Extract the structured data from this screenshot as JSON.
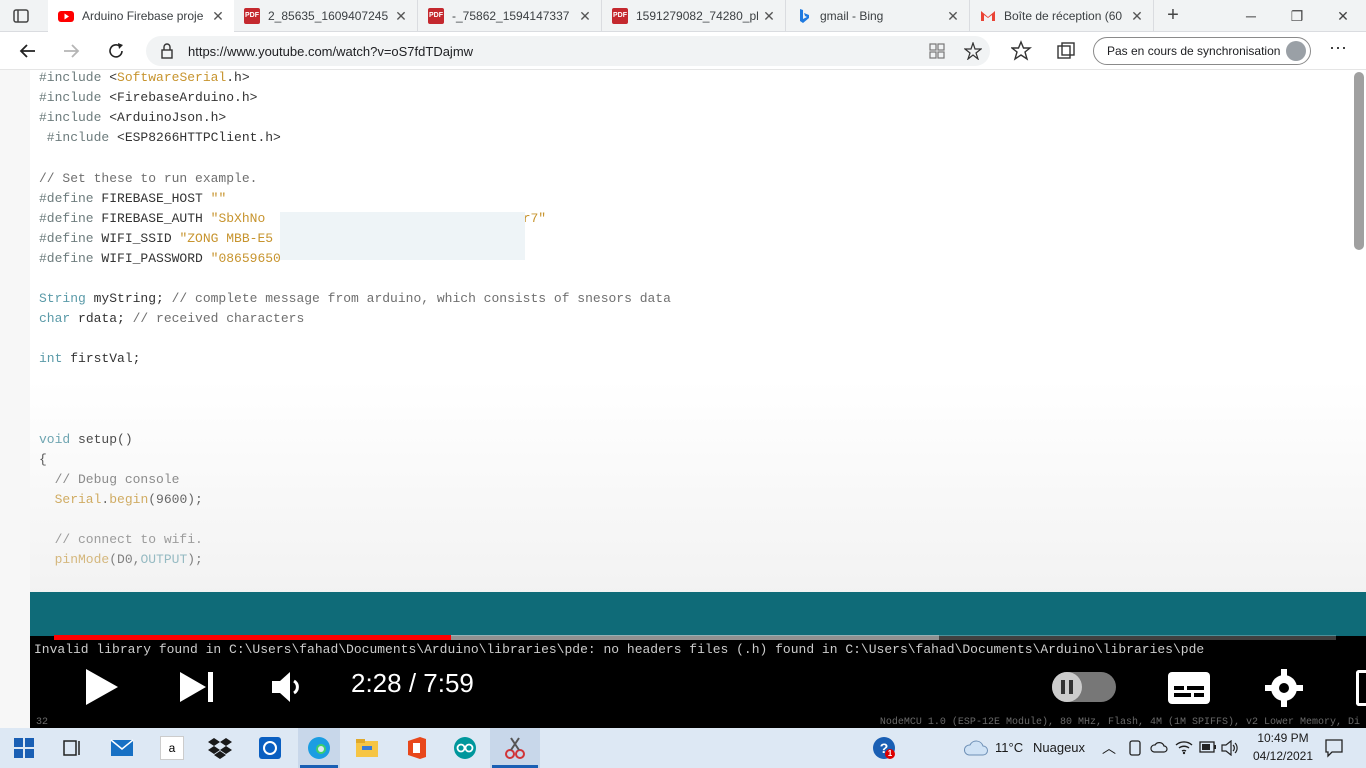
{
  "browser": {
    "tabs": [
      {
        "label": "Arduino Firebase proje",
        "icon": "youtube-icon",
        "active": true
      },
      {
        "label": "2_85635_1609407245",
        "icon": "pdf-icon"
      },
      {
        "label": "-_75862_1594147337",
        "icon": "pdf-icon"
      },
      {
        "label": "1591279082_74280_pl",
        "icon": "pdf-icon"
      },
      {
        "label": "gmail - Bing",
        "icon": "bing-icon"
      },
      {
        "label": "Boîte de réception (60",
        "icon": "gmail-icon"
      }
    ],
    "url": "https://www.youtube.com/watch?v=oS7fdTDajmw",
    "sync_label": "Pas en cours de synchronisation",
    "pdf_glyph": "PDF"
  },
  "video": {
    "code_lines": [
      {
        "tokens": [
          {
            "t": "#include ",
            "c": "kw"
          },
          {
            "t": "<",
            "c": ""
          },
          {
            "t": "SoftwareSerial",
            "c": "st"
          },
          {
            "t": ".h>",
            "c": ""
          }
        ]
      },
      {
        "tokens": [
          {
            "t": "#include ",
            "c": "kw"
          },
          {
            "t": "<FirebaseArduino.h>",
            "c": ""
          }
        ]
      },
      {
        "tokens": [
          {
            "t": "#include ",
            "c": "kw"
          },
          {
            "t": "<ArduinoJson.h>",
            "c": ""
          }
        ]
      },
      {
        "tokens": [
          {
            "t": " #include ",
            "c": "kw"
          },
          {
            "t": "<ESP8266HTTPClient.h>",
            "c": ""
          }
        ]
      },
      {
        "tokens": []
      },
      {
        "tokens": [
          {
            "t": "// Set these to run example.",
            "c": "cm"
          }
        ]
      },
      {
        "tokens": [
          {
            "t": "#define ",
            "c": "kw"
          },
          {
            "t": "FIREBASE_HOST ",
            "c": ""
          },
          {
            "t": "\"\"",
            "c": "st"
          }
        ]
      },
      {
        "tokens": [
          {
            "t": "#define ",
            "c": "kw"
          },
          {
            "t": "FIREBASE_AUTH ",
            "c": ""
          },
          {
            "t": "\"SbXhNo",
            "c": "st"
          },
          {
            "t": "                              ",
            "c": ""
          },
          {
            "t": "aD2r7\"",
            "c": "st"
          }
        ]
      },
      {
        "tokens": [
          {
            "t": "#define ",
            "c": "kw"
          },
          {
            "t": "WIFI_SSID ",
            "c": ""
          },
          {
            "t": "\"ZONG MBB-E5",
            "c": "st"
          }
        ]
      },
      {
        "tokens": [
          {
            "t": "#define ",
            "c": "kw"
          },
          {
            "t": "WIFI_PASSWORD ",
            "c": ""
          },
          {
            "t": "\"08659650\"",
            "c": "st"
          }
        ]
      },
      {
        "tokens": []
      },
      {
        "tokens": [
          {
            "t": "String ",
            "c": "ty"
          },
          {
            "t": "myString; ",
            "c": ""
          },
          {
            "t": "// complete message from arduino, which consists of snesors data",
            "c": "cm"
          }
        ]
      },
      {
        "tokens": [
          {
            "t": "char ",
            "c": "ty"
          },
          {
            "t": "rdata; ",
            "c": ""
          },
          {
            "t": "// received characters",
            "c": "cm"
          }
        ]
      },
      {
        "tokens": []
      },
      {
        "tokens": [
          {
            "t": "int ",
            "c": "ty"
          },
          {
            "t": "firstVal;",
            "c": ""
          }
        ]
      },
      {
        "tokens": []
      },
      {
        "tokens": []
      },
      {
        "tokens": []
      },
      {
        "tokens": [
          {
            "t": "void ",
            "c": "ty"
          },
          {
            "t": "setup()",
            "c": ""
          }
        ]
      },
      {
        "tokens": [
          {
            "t": "{",
            "c": ""
          }
        ]
      },
      {
        "tokens": [
          {
            "t": "  // Debug console",
            "c": "cm"
          }
        ]
      },
      {
        "tokens": [
          {
            "t": "  Serial",
            "c": "st"
          },
          {
            "t": ".",
            "c": ""
          },
          {
            "t": "begin",
            "c": "st"
          },
          {
            "t": "(9600);",
            "c": ""
          }
        ]
      },
      {
        "tokens": []
      },
      {
        "tokens": [
          {
            "t": "  // connect to wifi.",
            "c": "cm"
          }
        ]
      },
      {
        "tokens": [
          {
            "t": "  pinMode",
            "c": "st"
          },
          {
            "t": "(D0,",
            "c": ""
          },
          {
            "t": "OUTPUT",
            "c": "ty"
          },
          {
            "t": ");",
            "c": ""
          }
        ]
      }
    ],
    "console_message": "Invalid library found in C:\\Users\\fahad\\Documents\\Arduino\\libraries\\pde: no headers files (.h) found in C:\\Users\\fahad\\Documents\\Arduino\\libraries\\pde",
    "status_line": "NodeMCU 1.0 (ESP-12E Module), 80 MHz, Flash, 4M (1M SPIFFS), v2 Lower Memory, Di",
    "line_number": "32",
    "time_display": "2:28 / 7:59",
    "progress_played": 0.31,
    "progress_buffered": 0.69,
    "accent_red": "#ff0000"
  },
  "taskbar": {
    "weather_temp": "11°C",
    "weather_text": "Nuageux",
    "time": "10:49 PM",
    "date": "04/12/2021",
    "help_badge": "1",
    "amazon_glyph": "a"
  }
}
